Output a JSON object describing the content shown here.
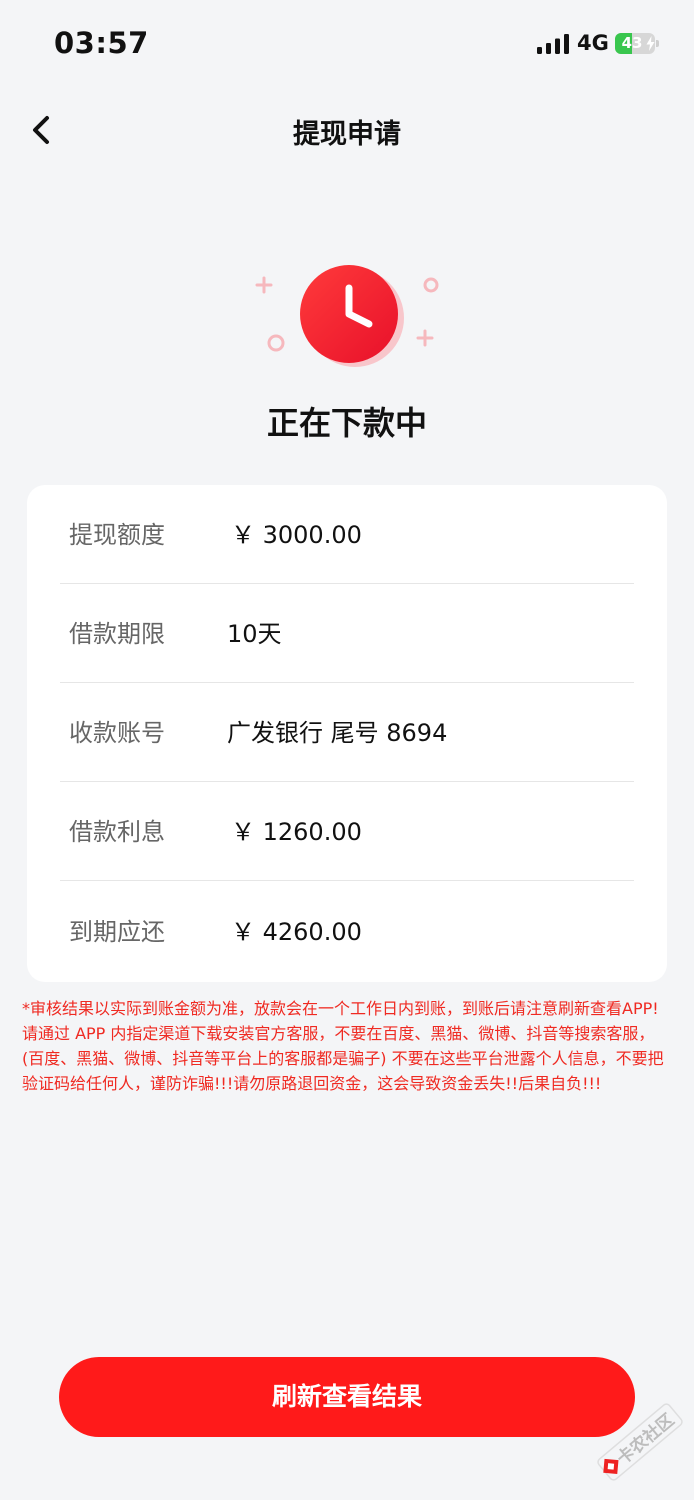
{
  "status_bar": {
    "time": "03:57",
    "network": "4G",
    "battery_level": "43",
    "battery_fraction": 0.43
  },
  "nav": {
    "title": "提现申请",
    "back_icon": "chevron-left-icon"
  },
  "status": {
    "icon": "clock-icon",
    "title": "正在下款中"
  },
  "details": [
    {
      "label": "提现额度",
      "value": "￥ 3000.00"
    },
    {
      "label": "借款期限",
      "value": "10天"
    },
    {
      "label": "收款账号",
      "value": "广发银行 尾号 8694"
    },
    {
      "label": "借款利息",
      "value": "￥ 1260.00"
    },
    {
      "label": "到期应还",
      "value": "￥ 4260.00"
    }
  ],
  "notice": "*审核结果以实际到账金额为准，放款会在一个工作日内到账，到账后请注意刷新查看APP! 请通过 APP 内指定渠道下载安装官方客服，不要在百度、黑猫、微博、抖音等搜索客服，(百度、黑猫、微博、抖音等平台上的客服都是骗子) 不要在这些平台泄露个人信息，不要把验证码给任何人，谨防诈骗!!!请勿原路退回资金，这会导致资金丢失!!后果自负!!!",
  "action": {
    "refresh_label": "刷新查看结果"
  },
  "watermark": {
    "text": "卡农社区"
  },
  "colors": {
    "accent": "#ff1a1a",
    "notice": "#ef2a22",
    "background": "#f4f5f7"
  }
}
